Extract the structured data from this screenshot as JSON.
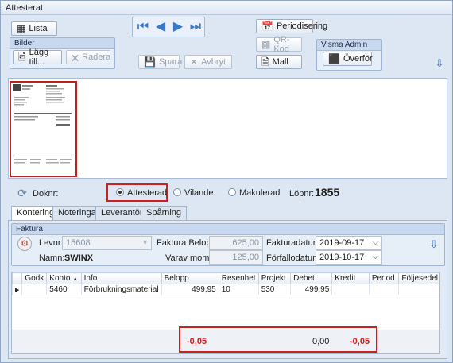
{
  "window": {
    "title": "Attesterat"
  },
  "toolbar": {
    "lista_label": "Lista",
    "bilder_group": "Bilder",
    "lagg_till_label": "Lägg till...",
    "radera_label": "Radera",
    "spara_label": "Spara",
    "avbryt_label": "Avbryt",
    "periodisering_label": "Periodisering",
    "qr_label": "QR-Kod",
    "mall_label": "Mall",
    "visma_group": "Visma Admin",
    "overfor_label": "Överför"
  },
  "status": {
    "doknr_label": "Doknr:",
    "options": [
      "Attesterad",
      "Vilande",
      "Makulerad"
    ],
    "selected": "Attesterad",
    "lopnr_label": "Löpnr:",
    "lopnr_value": "1855"
  },
  "tabs": [
    "Kontering",
    "Noteringar",
    "Leverantör",
    "Spårning"
  ],
  "faktura": {
    "title": "Faktura",
    "levnr_label": "Levnr:",
    "levnr_value": "15608",
    "namn_label": "Namn:",
    "namn_value": "SWINX",
    "belopp_label": "Faktura Belopp:",
    "belopp_value": "625,00",
    "moms_label": "Varav moms:",
    "moms_value": "125,00",
    "fakturadatum_label": "Fakturadatum:",
    "fakturadatum_value": "2019-09-17",
    "forfallodatum_label": "Förfallodatum:",
    "forfallodatum_value": "2019-10-17"
  },
  "grid": {
    "columns": [
      "Godk",
      "Konto",
      "Info",
      "Belopp",
      "Resenhet",
      "Projekt",
      "Debet",
      "Kredit",
      "Period",
      "Följesedel"
    ],
    "rows": [
      {
        "godk": "",
        "konto": "5460",
        "info": "Förbrukningsmaterial",
        "belopp": "499,95",
        "resenhet": "10",
        "projekt": "530",
        "debet": "499,95",
        "kredit": "",
        "period": "",
        "foljesedel": ""
      }
    ],
    "totals": {
      "belopp": "-0,05",
      "debet": "0,00",
      "kredit": "-0,05"
    }
  },
  "colors": {
    "accent": "#3a78c8",
    "highlight": "#cc2121"
  }
}
